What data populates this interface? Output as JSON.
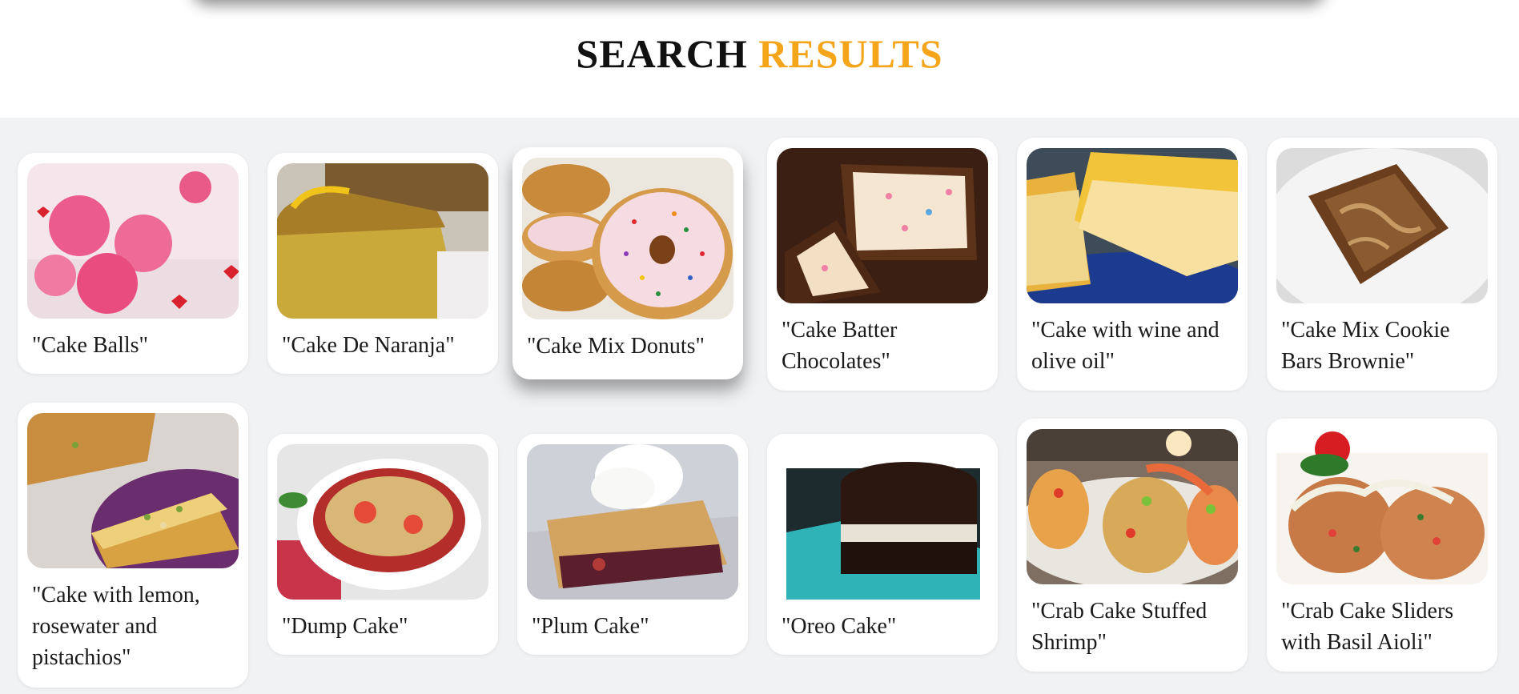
{
  "heading": {
    "part1": "SEARCH",
    "part2": "RESULTS"
  },
  "colors": {
    "accent": "#f5a51a",
    "background": "#f1f2f4",
    "card": "#ffffff"
  },
  "results": [
    {
      "title": "\"Cake Balls\"",
      "image": "pink-cake-balls-photo"
    },
    {
      "title": "\"Cake De Naranja\"",
      "image": "orange-cake-slice-photo"
    },
    {
      "title": "\"Cake Mix Donuts\"",
      "image": "sprinkle-donuts-photo"
    },
    {
      "title": "\"Cake Batter Chocolates\"",
      "image": "cake-batter-chocolates-photo"
    },
    {
      "title": "\"Cake with wine and olive oil\"",
      "image": "olive-oil-cake-photo"
    },
    {
      "title": "\"Cake Mix Cookie Bars Brownie\"",
      "image": "cookie-bars-brownie-photo"
    },
    {
      "title": "\"Cake with lemon, rosewater and pistachios\"",
      "image": "lemon-pistachio-cake-photo"
    },
    {
      "title": "\"Dump Cake\"",
      "image": "dump-cake-photo"
    },
    {
      "title": "\"Plum Cake\"",
      "image": "plum-cake-photo"
    },
    {
      "title": "\"Oreo Cake\"",
      "image": "oreo-cake-photo"
    },
    {
      "title": "\"Crab Cake Stuffed Shrimp\"",
      "image": "crab-cake-shrimp-photo"
    },
    {
      "title": "\"Crab Cake Sliders with Basil Aioli\"",
      "image": "crab-cake-sliders-photo"
    }
  ]
}
